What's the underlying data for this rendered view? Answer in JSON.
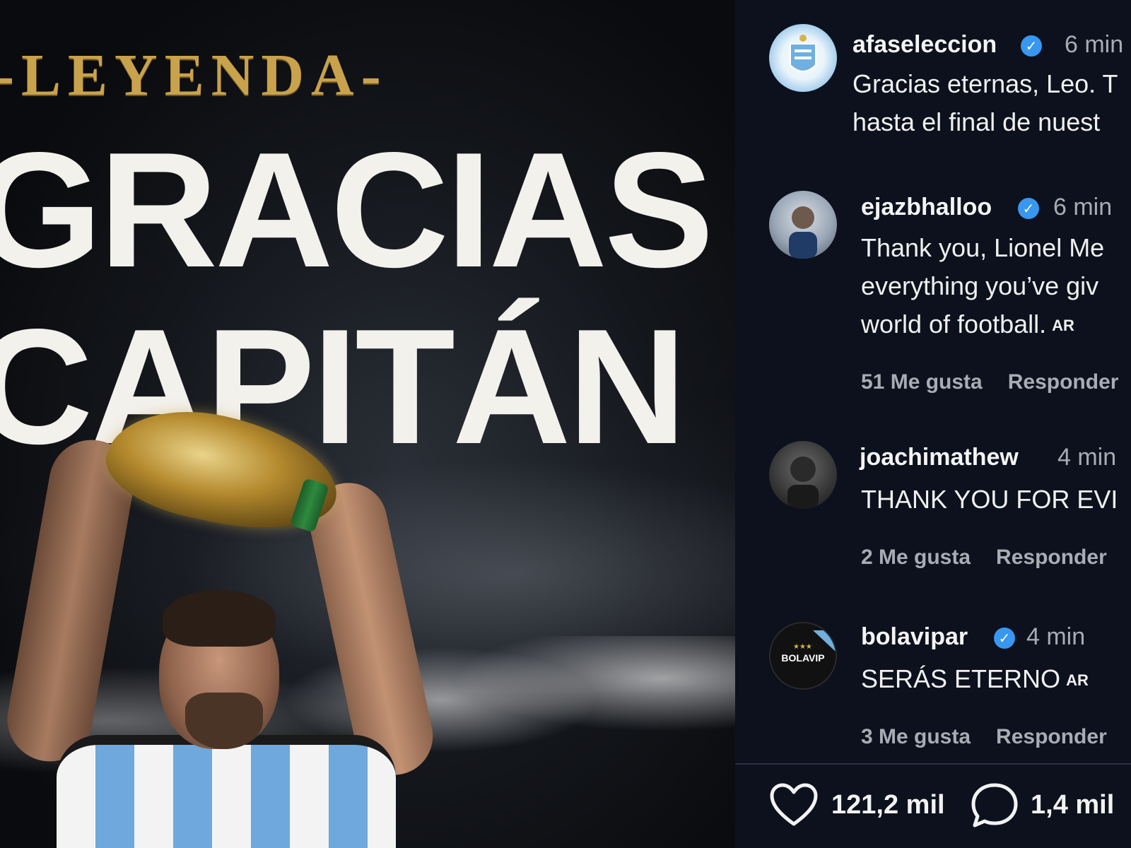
{
  "poster": {
    "kicker": "-LEYENDA-",
    "line1": "GRACIAS",
    "line2": "CAPITÁN"
  },
  "comments": [
    {
      "username": "afaseleccion",
      "verified": true,
      "time": "6 min",
      "text_lines": [
        "Gracias eternas, Leo. T",
        "hasta el final de nuest"
      ],
      "avatar_icon": "afa-crest-icon"
    },
    {
      "username": "ejazbhalloo",
      "verified": true,
      "time": "6 min",
      "text_lines": [
        "Thank you, Lionel Me",
        "everything you’ve giv",
        "world of football."
      ],
      "tag": "AR",
      "likes": "51 Me gusta",
      "reply": "Responder",
      "avatar_icon": "user-photo-icon"
    },
    {
      "username": "joachimathew",
      "verified": false,
      "time": "4 min",
      "text_lines": [
        "THANK YOU FOR EVI"
      ],
      "likes": "2 Me gusta",
      "reply": "Responder",
      "avatar_icon": "user-photo-icon"
    },
    {
      "username": "bolavipar",
      "verified": true,
      "time": "4 min",
      "text_lines": [
        "SERÁS ETERNO"
      ],
      "tag": "AR",
      "likes": "3 Me gusta",
      "reply": "Responder",
      "avatar_icon": "bolavip-logo-icon",
      "avatar_label": "BOLAVIP"
    }
  ],
  "actions": {
    "likes_count": "121,2 mil",
    "comments_count": "1,4 mil",
    "like_icon": "heart-icon",
    "comment_icon": "comment-bubble-icon"
  },
  "colors": {
    "panel_bg": "#0c111d",
    "verified_blue": "#3897f0",
    "gold": "#c9a24c",
    "muted_text": "#a8acb3"
  }
}
